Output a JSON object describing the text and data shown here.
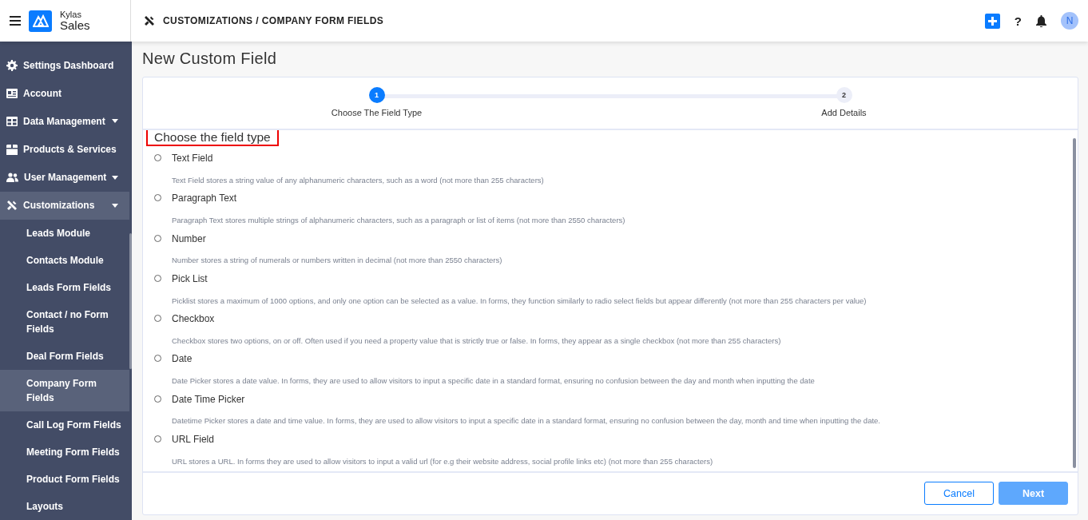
{
  "header": {
    "brand_small": "Kylas",
    "brand_large": "Sales",
    "breadcrumb": "CUSTOMIZATIONS / COMPANY FORM FIELDS",
    "help": "?",
    "avatar": "N"
  },
  "sidebar": {
    "items": [
      {
        "label": "Settings Dashboard",
        "expandable": false,
        "selected": false
      },
      {
        "label": "Account",
        "expandable": false,
        "selected": false
      },
      {
        "label": "Data Management",
        "expandable": true,
        "selected": false
      },
      {
        "label": "Products & Services",
        "expandable": false,
        "selected": false
      },
      {
        "label": "User Management",
        "expandable": true,
        "selected": false
      },
      {
        "label": "Customizations",
        "expandable": true,
        "selected": true,
        "expanded": true,
        "children": [
          {
            "label": "Leads Module",
            "selected": false
          },
          {
            "label": "Contacts Module",
            "selected": false
          },
          {
            "label": "Leads Form Fields",
            "selected": false
          },
          {
            "label": "Contact / no Form Fields",
            "selected": false
          },
          {
            "label": "Deal Form Fields",
            "selected": false
          },
          {
            "label": "Company Form Fields",
            "selected": true
          },
          {
            "label": "Call Log Form Fields",
            "selected": false
          },
          {
            "label": "Meeting Form Fields",
            "selected": false
          },
          {
            "label": "Product Form Fields",
            "selected": false
          },
          {
            "label": "Layouts",
            "selected": false
          }
        ]
      }
    ]
  },
  "page": {
    "title": "New Custom Field",
    "steps": [
      {
        "number": "1",
        "label": "Choose The Field Type",
        "active": true
      },
      {
        "number": "2",
        "label": "Add Details",
        "active": false
      }
    ],
    "section_title": "Choose the field type",
    "options": [
      {
        "label": "Text Field",
        "description": "Text Field stores a string value of any alphanumeric characters, such as a word (not more than 255 characters)",
        "selected": false
      },
      {
        "label": "Paragraph Text",
        "description": "Paragraph Text stores multiple strings of alphanumeric characters, such as a paragraph or list of items (not more than 2550 characters)",
        "selected": false
      },
      {
        "label": "Number",
        "description": "Number stores a string of numerals or numbers written in decimal (not more than 2550 characters)",
        "selected": false
      },
      {
        "label": "Pick List",
        "description": "Picklist stores a maximum of 1000 options, and only one option can be selected as a value. In forms, they function similarly to radio select fields but appear differently (not more than 255 characters per value)",
        "selected": false
      },
      {
        "label": "Checkbox",
        "description": "Checkbox stores two options, on or off. Often used if you need a property value that is strictly true or false. In forms, they appear as a single checkbox (not more than 255 characters)",
        "selected": false
      },
      {
        "label": "Date",
        "description": "Date Picker stores a date value. In forms, they are used to allow visitors to input a specific date in a standard format, ensuring no confusion between the day and month when inputting the date",
        "selected": false
      },
      {
        "label": "Date Time Picker",
        "description": "Datetime Picker stores a date and time value. In forms, they are used to allow visitors to input a specific date in a standard format, ensuring no confusion between the day, month and time when inputting the date.",
        "selected": false
      },
      {
        "label": "URL Field",
        "description": "URL stores a URL. In forms they are used to allow visitors to input a valid url (for e.g their website address, social profile links etc) (not more than 255 characters)",
        "selected": false
      }
    ],
    "buttons": [
      {
        "kind": "secondary",
        "label": "Cancel",
        "disabled": false
      },
      {
        "kind": "primary",
        "label": "Next",
        "disabled": true
      }
    ]
  }
}
